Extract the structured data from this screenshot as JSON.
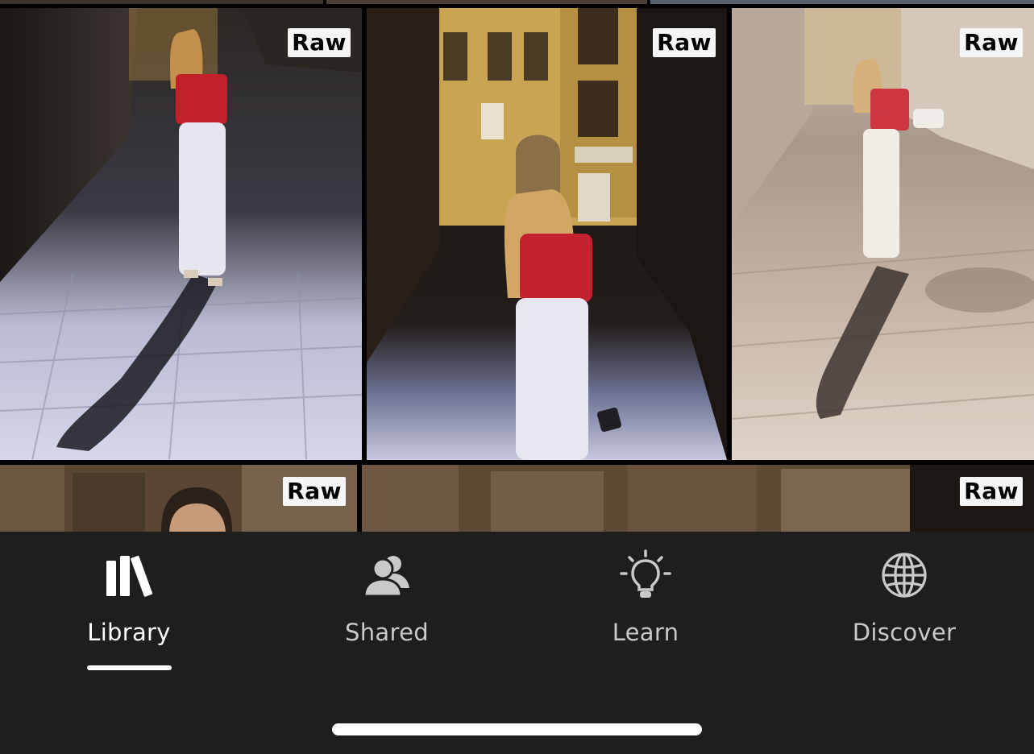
{
  "photos": {
    "badge": "Raw",
    "items": [
      {
        "id": "p1",
        "badge": "Raw"
      },
      {
        "id": "p2",
        "badge": "Raw"
      },
      {
        "id": "p3",
        "badge": "Raw"
      },
      {
        "id": "p4",
        "badge": "Raw"
      },
      {
        "id": "p5",
        "badge": "Raw"
      }
    ]
  },
  "tabbar": {
    "tabs": [
      {
        "label": "Library",
        "icon": "library-icon",
        "active": true
      },
      {
        "label": "Shared",
        "icon": "people-icon",
        "active": false
      },
      {
        "label": "Learn",
        "icon": "lightbulb-icon",
        "active": false
      },
      {
        "label": "Discover",
        "icon": "globe-icon",
        "active": false
      }
    ]
  },
  "colors": {
    "tabbar_bg": "#1e1e1e",
    "active": "#ffffff",
    "inactive": "#c9c9c9",
    "badge_bg": "#f5f5f5"
  }
}
